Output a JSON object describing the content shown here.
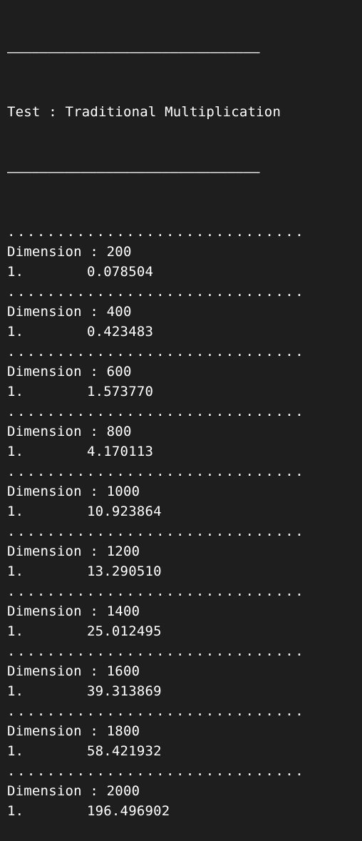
{
  "terminal": {
    "rule_top": "———————————————————————————————",
    "title": "Test : Traditional Multiplication",
    "rule_bottom": "———————————————————————————————",
    "separator": "..............................",
    "blocks": [
      {
        "dimension": "Dimension : 200",
        "index": "1.",
        "time": "0.078504"
      },
      {
        "dimension": "Dimension : 400",
        "index": "1.",
        "time": "0.423483"
      },
      {
        "dimension": "Dimension : 600",
        "index": "1.",
        "time": "1.573770"
      },
      {
        "dimension": "Dimension : 800",
        "index": "1.",
        "time": "4.170113"
      },
      {
        "dimension": "Dimension : 1000",
        "index": "1.",
        "time": "10.923864"
      },
      {
        "dimension": "Dimension : 1200",
        "index": "1.",
        "time": "13.290510"
      },
      {
        "dimension": "Dimension : 1400",
        "index": "1.",
        "time": "25.012495"
      },
      {
        "dimension": "Dimension : 1600",
        "index": "1.",
        "time": "39.313869"
      },
      {
        "dimension": "Dimension : 1800",
        "index": "1.",
        "time": "58.421932"
      },
      {
        "dimension": "Dimension : 2000",
        "index": "1.",
        "time": "196.496902"
      }
    ]
  }
}
